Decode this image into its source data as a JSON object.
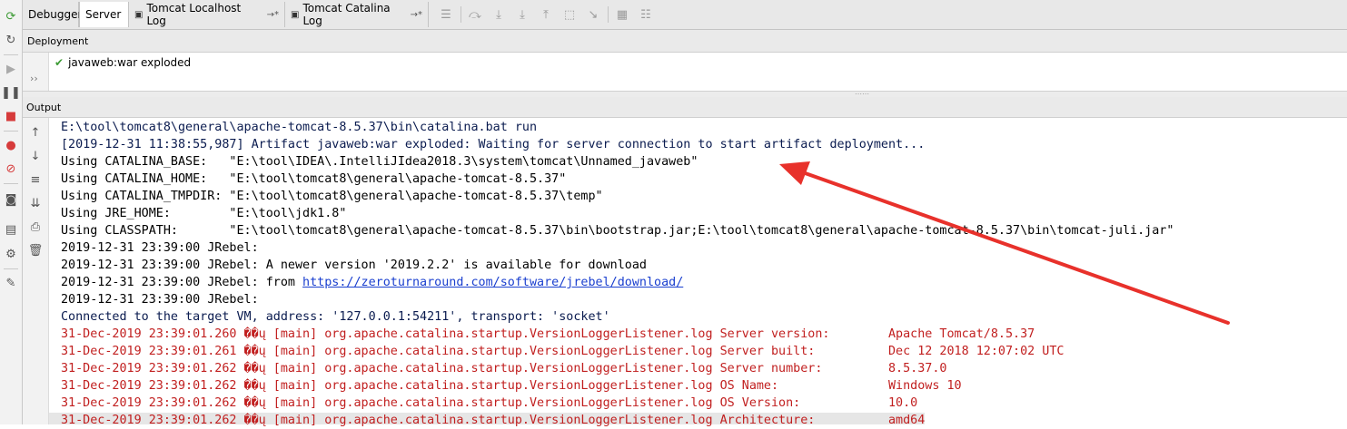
{
  "tabs": [
    {
      "label": "Debugger",
      "suffix": "",
      "active": false
    },
    {
      "label": "Server",
      "suffix": "",
      "active": true
    },
    {
      "label": "Tomcat Localhost Log",
      "suffix": "→*",
      "active": false
    },
    {
      "label": "Tomcat Catalina Log",
      "suffix": "→*",
      "active": false
    }
  ],
  "deployment": {
    "header": "Deployment",
    "item": "javaweb:war exploded"
  },
  "output": {
    "header": "Output",
    "lines": [
      {
        "type": "info",
        "text": "E:\\tool\\tomcat8\\general\\apache-tomcat-8.5.37\\bin\\catalina.bat run"
      },
      {
        "type": "info",
        "text": "[2019-12-31 11:38:55,987] Artifact javaweb:war exploded: Waiting for server connection to start artifact deployment..."
      },
      {
        "type": "out",
        "text": "Using CATALINA_BASE:   \"E:\\tool\\IDEA\\.IntelliJIdea2018.3\\system\\tomcat\\Unnamed_javaweb\""
      },
      {
        "type": "out",
        "text": "Using CATALINA_HOME:   \"E:\\tool\\tomcat8\\general\\apache-tomcat-8.5.37\""
      },
      {
        "type": "out",
        "text": "Using CATALINA_TMPDIR: \"E:\\tool\\tomcat8\\general\\apache-tomcat-8.5.37\\temp\""
      },
      {
        "type": "out",
        "text": "Using JRE_HOME:        \"E:\\tool\\jdk1.8\""
      },
      {
        "type": "out",
        "text": "Using CLASSPATH:       \"E:\\tool\\tomcat8\\general\\apache-tomcat-8.5.37\\bin\\bootstrap.jar;E:\\tool\\tomcat8\\general\\apache-tomcat-8.5.37\\bin\\tomcat-juli.jar\""
      },
      {
        "type": "out",
        "text": "2019-12-31 23:39:00 JRebel:"
      },
      {
        "type": "out",
        "text": "2019-12-31 23:39:00 JRebel: A newer version '2019.2.2' is available for download"
      },
      {
        "type": "out",
        "text": "2019-12-31 23:39:00 JRebel: from ",
        "link": "https://zeroturnaround.com/software/jrebel/download/"
      },
      {
        "type": "out",
        "text": "2019-12-31 23:39:00 JRebel:"
      },
      {
        "type": "info",
        "text": "Connected to the target VM, address: '127.0.0.1:54211', transport: 'socket'"
      },
      {
        "type": "err",
        "text": "31-Dec-2019 23:39:01.260 ��ų [main] org.apache.catalina.startup.VersionLoggerListener.log Server version:        Apache Tomcat/8.5.37"
      },
      {
        "type": "err",
        "text": "31-Dec-2019 23:39:01.261 ��ų [main] org.apache.catalina.startup.VersionLoggerListener.log Server built:          Dec 12 2018 12:07:02 UTC"
      },
      {
        "type": "err",
        "text": "31-Dec-2019 23:39:01.262 ��ų [main] org.apache.catalina.startup.VersionLoggerListener.log Server number:         8.5.37.0"
      },
      {
        "type": "err",
        "text": "31-Dec-2019 23:39:01.262 ��ų [main] org.apache.catalina.startup.VersionLoggerListener.log OS Name:               Windows 10"
      },
      {
        "type": "err",
        "text": "31-Dec-2019 23:39:01.262 ��ų [main] org.apache.catalina.startup.VersionLoggerListener.log OS Version:            10.0"
      },
      {
        "type": "err",
        "text": "31-Dec-2019 23:39:01.262 ��ų [main] org.apache.catalina.startup.VersionLoggerListener.log Architecture:          amd64"
      }
    ]
  },
  "colors": {
    "info": "#0a1b4f",
    "out": "#000000",
    "err": "#c11f1f",
    "link": "#1a3fcf",
    "arrow": "#e8312b",
    "success_check": "#3d9b35"
  }
}
